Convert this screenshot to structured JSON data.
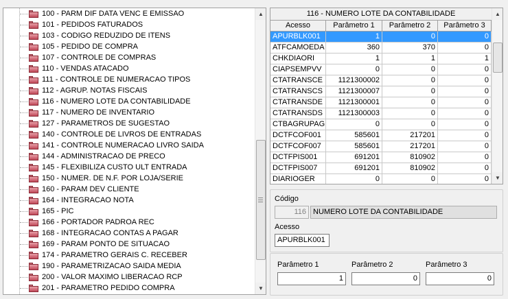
{
  "tree": {
    "items": [
      "100 - PARM DIF DATA VENC E EMISSAO",
      "101 - PEDIDOS FATURADOS",
      "103 - CODIGO REDUZIDO DE ITENS",
      "105 - PEDIDO DE COMPRA",
      "107 - CONTROLE DE COMPRAS",
      "110 - VENDAS ATACADO",
      "111 - CONTROLE DE NUMERACAO TIPOS",
      "112 - AGRUP. NOTAS FISCAIS",
      "116 - NUMERO LOTE DA CONTABILIDADE",
      "117 - NUMERO DE INVENTARIO",
      "127 - PARAMETROS DE SUGESTAO",
      "140 - CONTROLE DE LIVROS DE ENTRADAS",
      "141 - CONTROLE NUMERACAO LIVRO SAIDA",
      "144 - ADMINISTRACAO DE PRECO",
      "145 - FLEXIBILIZA CUSTO ULT ENTRADA",
      "150 - NUMER. DE N.F. POR LOJA/SERIE",
      "160 - PARAM DEV CLIENTE",
      "164 - INTEGRACAO NOTA",
      "165 - PIC",
      "166 - PORTADOR PADROA REC",
      "168 - INTEGRACAO CONTAS A PAGAR",
      "169 - PARAM PONTO DE SITUACAO",
      "174 - PARAMETRO GERAIS C. RECEBER",
      "190 - PARAMETRIZACAO SAIDA MEDIA",
      "200 - VALOR MAXIMO LIBERACAO RCP",
      "201 - PARAMETRO PEDIDO COMPRA"
    ],
    "scroll_up": "▲",
    "scroll_down": "▼"
  },
  "grid": {
    "title": "116 - NUMERO LOTE DA CONTABILIDADE",
    "columns": [
      "Acesso",
      "Parâmetro 1",
      "Parâmetro 2",
      "Parâmetro 3"
    ],
    "selected_row": 0,
    "rows": [
      [
        "APURBLK001",
        "1",
        "0",
        "0"
      ],
      [
        "ATFCAMOEDA",
        "360",
        "370",
        "0"
      ],
      [
        "CHKDIAORI",
        "1",
        "1",
        "1"
      ],
      [
        "CIAPSEMPVV",
        "0",
        "0",
        "0"
      ],
      [
        "CTATRANSCE",
        "1121300002",
        "0",
        "0"
      ],
      [
        "CTATRANSCS",
        "1121300007",
        "0",
        "0"
      ],
      [
        "CTATRANSDE",
        "1121300001",
        "0",
        "0"
      ],
      [
        "CTATRANSDS",
        "1121300003",
        "0",
        "0"
      ],
      [
        "CTBAGRUPAG",
        "0",
        "0",
        "0"
      ],
      [
        "DCTFCOF001",
        "585601",
        "217201",
        "0"
      ],
      [
        "DCTFCOF007",
        "585601",
        "217201",
        "0"
      ],
      [
        "DCTFPIS001",
        "691201",
        "810902",
        "0"
      ],
      [
        "DCTFPIS007",
        "691201",
        "810902",
        "0"
      ],
      [
        "DIARIOGER",
        "0",
        "0",
        "0"
      ]
    ],
    "scroll_up": "▲",
    "scroll_down": "▼"
  },
  "details": {
    "codigo_label": "Código",
    "codigo_value": "116",
    "descricao_value": "NUMERO LOTE DA CONTABILIDADE",
    "acesso_label": "Acesso",
    "acesso_value": "APURBLK001",
    "param1_label": "Parâmetro 1",
    "param1_value": "1",
    "param2_label": "Parâmetro 2",
    "param2_value": "0",
    "param3_label": "Parâmetro 3",
    "param3_value": "0"
  }
}
